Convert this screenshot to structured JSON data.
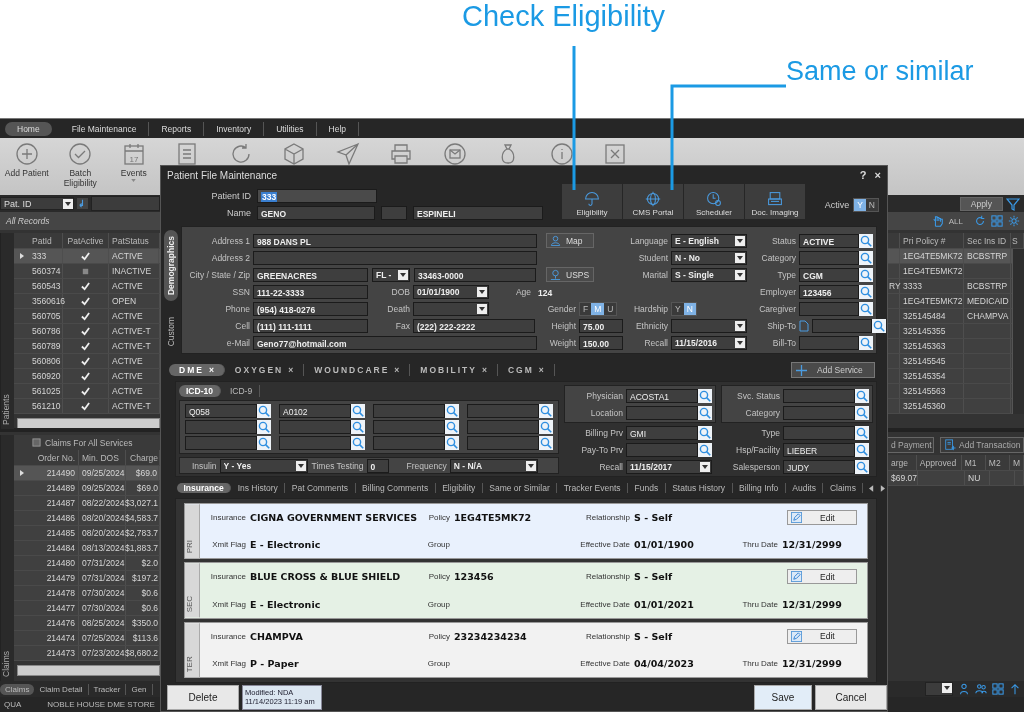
{
  "callouts": [
    {
      "text": "Check Eligibility"
    },
    {
      "text": "Same or similar"
    }
  ],
  "menu": [
    {
      "label": "Home",
      "selected": true
    },
    {
      "label": "File Maintenance",
      "selected": false
    },
    {
      "label": "Reports",
      "selected": false
    },
    {
      "label": "Inventory",
      "selected": false
    },
    {
      "label": "Utilities",
      "selected": false
    },
    {
      "label": "Help",
      "selected": false
    }
  ],
  "toolbar": [
    {
      "label": "Add Patient"
    },
    {
      "label": "Batch Eligibility"
    },
    {
      "label": "Events",
      "day": "17",
      "dropdown": true
    }
  ],
  "patients": {
    "side_label": "Patients",
    "search_field": "Pat. ID",
    "filter_label": "All Records",
    "apply_button": "Apply",
    "all_label": "ALL",
    "columns": [
      "PatId",
      "PatActive",
      "PatStatus"
    ],
    "right_columns": [
      "Pri Policy #",
      "Sec Ins ID",
      "S"
    ],
    "rows": [
      {
        "id": "333",
        "active": true,
        "status": "ACTIVE",
        "pri_policy": "1EG4TE5MK72",
        "sec_ins_id": "BCBSTRP",
        "selected": true
      },
      {
        "id": "560374",
        "active": false,
        "status": "INACTIVE",
        "pri_policy": "1EG4TE5MK72",
        "selected": false
      },
      {
        "id": "560543",
        "active": true,
        "status": "ACTIVE",
        "column_1": "RY",
        "pri_policy": "3333",
        "sec_ins_id": "BCBSTRP",
        "selected": false
      },
      {
        "id": "3560616",
        "active": true,
        "status": "OPEN",
        "pri_policy": "1EG4TE5MK72",
        "sec_ins_id": "MEDICAID",
        "selected": false
      },
      {
        "id": "560705",
        "active": true,
        "status": "ACTIVE",
        "pri_policy": "325145484",
        "sec_ins_id": "CHAMPVA",
        "selected": false
      },
      {
        "id": "560786",
        "active": true,
        "status": "ACTIVE-T",
        "pri_policy": "325145355",
        "selected": false
      },
      {
        "id": "560789",
        "active": true,
        "status": "ACTIVE-T",
        "pri_policy": "325145363",
        "selected": false
      },
      {
        "id": "560806",
        "active": true,
        "status": "ACTIVE",
        "pri_policy": "325145545",
        "selected": false
      },
      {
        "id": "560920",
        "active": true,
        "status": "ACTIVE",
        "pri_policy": "325145354",
        "selected": false
      },
      {
        "id": "561025",
        "active": true,
        "status": "ACTIVE",
        "pri_policy": "325145563",
        "selected": false
      },
      {
        "id": "561210",
        "active": true,
        "status": "ACTIVE-T",
        "pri_policy": "325145360",
        "selected": false
      }
    ]
  },
  "claims": {
    "side_label": "Claims",
    "title": "Claims For All Services",
    "all_checked": false,
    "columns": [
      "Order No.",
      "Min. DOS",
      "Charge"
    ],
    "rows": [
      {
        "order": "214490",
        "dos": "09/25/2024",
        "charge": "$69.0",
        "selected": true
      },
      {
        "order": "214489",
        "dos": "09/25/2024",
        "charge": "$69.0",
        "selected": false
      },
      {
        "order": "214487",
        "dos": "08/22/2024",
        "charge": "$3,027.1",
        "selected": false
      },
      {
        "order": "214486",
        "dos": "08/20/2024",
        "charge": "$4,583.7",
        "selected": false
      },
      {
        "order": "214485",
        "dos": "08/20/2024",
        "charge": "$2,783.7",
        "selected": false
      },
      {
        "order": "214484",
        "dos": "08/13/2024",
        "charge": "$1,883.7",
        "selected": false
      },
      {
        "order": "214480",
        "dos": "07/31/2024",
        "charge": "$2.0",
        "selected": false
      },
      {
        "order": "214479",
        "dos": "07/31/2024",
        "charge": "$197.2",
        "selected": false
      },
      {
        "order": "214478",
        "dos": "07/30/2024",
        "charge": "$0.6",
        "selected": false
      },
      {
        "order": "214477",
        "dos": "07/30/2024",
        "charge": "$0.6",
        "selected": false
      },
      {
        "order": "214476",
        "dos": "08/25/2024",
        "charge": "$350.0",
        "selected": false
      },
      {
        "order": "214474",
        "dos": "07/25/2024",
        "charge": "$113.6",
        "selected": false
      },
      {
        "order": "214473",
        "dos": "07/23/2024",
        "charge": "$8,680.2",
        "selected": false
      }
    ]
  },
  "transactions": {
    "buttons": [
      "d Payment",
      "Add Transaction"
    ],
    "columns": [
      "arge",
      "Approved",
      "M1",
      "M2",
      "M"
    ],
    "rows": [
      {
        "charge": "$69.07",
        "m1": "NU"
      }
    ]
  },
  "bottom_tabs": [
    {
      "label": "Claims",
      "selected": true
    },
    {
      "label": "Claim Detail",
      "selected": false
    },
    {
      "label": "Tracker",
      "selected": false
    },
    {
      "label": "Gen",
      "selected": false
    }
  ],
  "status_bar": [
    "QUA",
    "NOBLE HOUSE DME STORE"
  ],
  "dialog": {
    "title": "Patient File Maintenance",
    "help": "?",
    "close": "×",
    "patient_id": {
      "label": "Patient ID",
      "value": "333"
    },
    "name": {
      "label": "Name",
      "first": "GENO",
      "last": "ESPINELI"
    },
    "tools": [
      {
        "label": "Eligibility"
      },
      {
        "label": "CMS Portal"
      },
      {
        "label": "Scheduler"
      },
      {
        "label": "Doc. Imaging"
      }
    ],
    "active": {
      "label": "Active",
      "options": [
        {
          "label": "Y",
          "selected": true
        },
        {
          "label": "N",
          "selected": false
        }
      ]
    },
    "side_tabs": [
      {
        "label": "Demographics",
        "selected": true
      },
      {
        "label": "Custom",
        "selected": false
      }
    ],
    "demographics": [
      [
        [
          {
            "kind": "text",
            "label": "Address 1",
            "value": "988 DANS PL"
          }
        ],
        [
          {
            "kind": "text",
            "label": "Address 2"
          }
        ],
        [
          {
            "kind": "text",
            "label": "City / State / Zip",
            "value": "GREENACRES"
          },
          {
            "kind": "select",
            "value": "FL -"
          },
          {
            "kind": "text",
            "value": "33463-0000"
          }
        ],
        [
          {
            "kind": "text",
            "label": "SSN",
            "value": "111-22-3333"
          },
          {
            "kind": "select",
            "label": "DOB",
            "value": "01/01/1900"
          },
          {
            "kind": "readout",
            "label": "Age",
            "value": "124"
          }
        ],
        [
          {
            "kind": "text",
            "label": "Phone",
            "value": "(954) 418-0276"
          },
          {
            "kind": "select",
            "label": "Death"
          }
        ],
        [
          {
            "kind": "text",
            "label": "Cell",
            "value": "(111) 111-1111"
          },
          {
            "kind": "text",
            "label": "Fax",
            "value": "(222) 222-2222"
          }
        ],
        [
          {
            "kind": "text",
            "label": "e-Mail",
            "value": "Geno77@hotmail.com"
          }
        ]
      ],
      [
        [
          {
            "kind": "button",
            "label": "Map"
          }
        ],
        [
          {
            "kind": "button",
            "label": "USPS"
          }
        ],
        [
          {
            "kind": "toggle",
            "label": "Gender",
            "options": [
              {
                "label": "F",
                "selected": false
              },
              {
                "label": "M",
                "selected": true
              },
              {
                "label": "U",
                "selected": false
              }
            ]
          }
        ],
        [
          {
            "kind": "text",
            "label": "Height",
            "value": "75.00"
          }
        ],
        [
          {
            "kind": "text",
            "label": "Weight",
            "value": "150.00"
          }
        ]
      ],
      [
        [
          {
            "kind": "select",
            "label": "Language",
            "value": "E - English"
          }
        ],
        [
          {
            "kind": "select",
            "label": "Student",
            "value": "N - No"
          }
        ],
        [
          {
            "kind": "select",
            "label": "Marital",
            "value": "S - Single"
          }
        ],
        [
          {
            "kind": "toggle",
            "label": "Hardship",
            "options": [
              {
                "label": "Y",
                "selected": false
              },
              {
                "label": "N",
                "selected": true
              }
            ]
          }
        ],
        [
          {
            "kind": "select",
            "label": "Ethnicity"
          }
        ],
        [
          {
            "kind": "select",
            "label": "Recall",
            "value": "11/15/2016"
          }
        ]
      ],
      [
        [
          {
            "kind": "lookup",
            "label": "Status",
            "value": "ACTIVE"
          }
        ],
        [
          {
            "kind": "lookup",
            "label": "Category"
          }
        ],
        [
          {
            "kind": "lookup",
            "label": "Type",
            "value": "CGM"
          }
        ],
        [
          {
            "kind": "lookup",
            "label": "Employer",
            "value": "123456"
          }
        ],
        [
          {
            "kind": "lookup",
            "label": "Caregiver"
          }
        ],
        [
          {
            "kind": "lookup",
            "label": "Ship-To",
            "attachment": true
          }
        ],
        [
          {
            "kind": "lookup",
            "label": "Bill-To"
          }
        ]
      ]
    ],
    "services": {
      "tabs": [
        {
          "label": "DME",
          "selected": true
        },
        {
          "label": "OXYGEN",
          "selected": false
        },
        {
          "label": "WOUNDCARE",
          "selected": false
        },
        {
          "label": "MOBILITY",
          "selected": false
        },
        {
          "label": "CGM",
          "selected": false
        }
      ],
      "close": "×",
      "add_button": "Add Service",
      "code_tabs": [
        {
          "label": "ICD-10",
          "selected": true
        },
        {
          "label": "ICD-9",
          "selected": false
        }
      ],
      "codes": [
        "Q058",
        "A0102"
      ],
      "options": [
        {
          "kind": "select",
          "label": "Insulin",
          "value": "Y - Yes"
        },
        {
          "kind": "readout",
          "label": "Times Testing",
          "value": "0"
        },
        {
          "kind": "select",
          "label": "Frequency",
          "value": "N - N/A"
        }
      ],
      "providers": [
        {
          "kind": "lookup",
          "label": "Physician",
          "value": "ACOSTA1"
        },
        {
          "kind": "lookup",
          "label": "Location"
        },
        {
          "kind": "lookup",
          "label": "Billing Prv",
          "value": "GMI"
        },
        {
          "kind": "lookup",
          "label": "Pay-To Prv"
        },
        {
          "kind": "select",
          "label": "Recall",
          "value": "11/15/2017"
        }
      ],
      "service_info": [
        {
          "kind": "lookup",
          "label": "Svc. Status"
        },
        {
          "kind": "lookup",
          "label": "Category"
        },
        {
          "kind": "lookup",
          "label": "Type"
        },
        {
          "kind": "lookup",
          "label": "Hsp/Facility",
          "value": "LIEBER"
        },
        {
          "kind": "lookup",
          "label": "Salesperson",
          "value": "JUDY"
        }
      ]
    },
    "record_tabs": [
      {
        "label": "Insurance",
        "selected": true
      },
      {
        "label": "Ins History",
        "selected": false
      },
      {
        "label": "Pat Comments",
        "selected": false
      },
      {
        "label": "Billing Comments",
        "selected": false
      },
      {
        "label": "Eligibility",
        "selected": false
      },
      {
        "label": "Same or Similar",
        "selected": false
      },
      {
        "label": "Tracker Events",
        "selected": false
      },
      {
        "label": "Funds",
        "selected": false
      },
      {
        "label": "Status History",
        "selected": false
      },
      {
        "label": "Billing Info",
        "selected": false
      },
      {
        "label": "Audits",
        "selected": false
      },
      {
        "label": "Claims",
        "selected": false
      }
    ],
    "insurance": [
      {
        "rank": "PRI",
        "color": "#e9f1fd",
        "edit_button": "Edit",
        "fields": [
          {
            "label": "Insurance",
            "value": "CIGNA GOVERNMENT SERVICES"
          },
          {
            "label": "Policy",
            "value": "1EG4TE5MK72"
          },
          {
            "label": "Relationship",
            "value": "S - Self"
          },
          {
            "label": "Xmit Flag",
            "value": "E - Electronic"
          },
          {
            "label": "Group"
          },
          {
            "label": "Effective Date",
            "value": "01/01/1900"
          },
          {
            "label": "Thru Date",
            "value": "12/31/2999"
          }
        ]
      },
      {
        "rank": "SEC",
        "color": "#e5f1e5",
        "edit_button": "Edit",
        "fields": [
          {
            "label": "Insurance",
            "value": "BLUE CROSS & BLUE SHIELD"
          },
          {
            "label": "Policy",
            "value": "123456"
          },
          {
            "label": "Relationship",
            "value": "S - Self"
          },
          {
            "label": "Xmit Flag",
            "value": "E - Electronic"
          },
          {
            "label": "Group"
          },
          {
            "label": "Effective Date",
            "value": "01/01/2021"
          },
          {
            "label": "Thru Date",
            "value": "12/31/2999"
          }
        ]
      },
      {
        "rank": "TER",
        "color": "#f2f2f2",
        "edit_button": "Edit",
        "fields": [
          {
            "label": "Insurance",
            "value": "CHAMPVA"
          },
          {
            "label": "Policy",
            "value": "23234234234"
          },
          {
            "label": "Relationship",
            "value": "S - Self"
          },
          {
            "label": "Xmit Flag",
            "value": "P - Paper"
          },
          {
            "label": "Group"
          },
          {
            "label": "Effective Date",
            "value": "04/04/2023"
          },
          {
            "label": "Thru Date",
            "value": "12/31/2999"
          }
        ]
      }
    ],
    "delete_button": "Delete",
    "modified": [
      "Modified: NDA",
      "11/14/2023 11:19 am"
    ],
    "save_button": "Save",
    "cancel_button": "Cancel"
  }
}
